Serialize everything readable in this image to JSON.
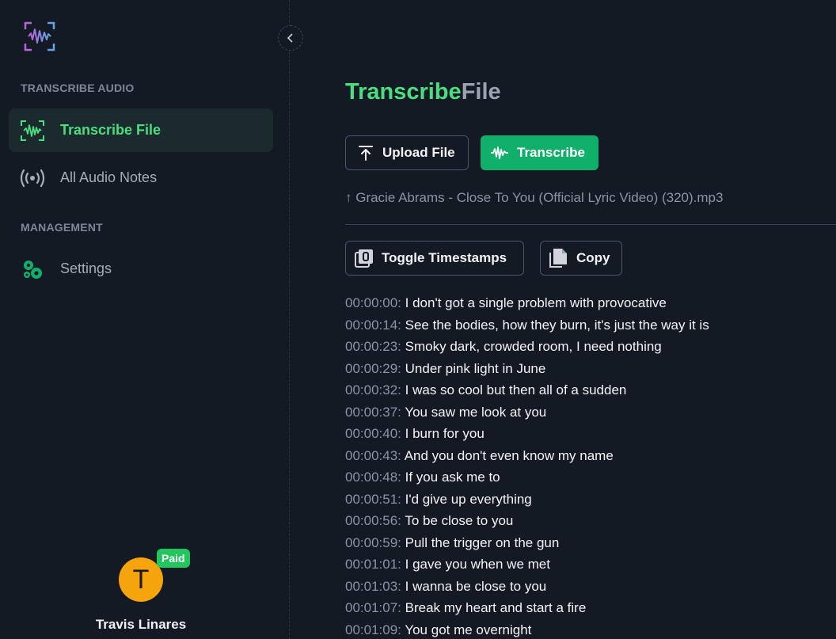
{
  "sidebar": {
    "sections": [
      {
        "title": "TRANSCRIBE AUDIO"
      },
      {
        "title": "MANAGEMENT"
      }
    ],
    "items": [
      {
        "label": "Transcribe File",
        "icon": "waveform-scan-icon"
      },
      {
        "label": "All Audio Notes",
        "icon": "broadcast-icon"
      },
      {
        "label": "Settings",
        "icon": "gears-icon"
      }
    ],
    "user": {
      "initial": "T",
      "badge": "Paid",
      "name": "Travis Linares"
    }
  },
  "main": {
    "title_part1": "Transcribe",
    "title_part2": "File",
    "upload_label": "Upload File",
    "transcribe_label": "Transcribe",
    "file_name": "↑ Gracie Abrams - Close To You (Official Lyric Video) (320).mp3",
    "toggle_label": "Toggle Timestamps",
    "copy_label": "Copy",
    "transcript": [
      {
        "time": "00:00:00:",
        "text": "I don't got a single problem with provocative"
      },
      {
        "time": "00:00:14:",
        "text": "See the bodies, how they burn, it's just the way it is"
      },
      {
        "time": "00:00:23:",
        "text": "Smoky dark, crowded room, I need nothing"
      },
      {
        "time": "00:00:29:",
        "text": "Under pink light in June"
      },
      {
        "time": "00:00:32:",
        "text": "I was so cool but then all of a sudden"
      },
      {
        "time": "00:00:37:",
        "text": "You saw me look at you"
      },
      {
        "time": "00:00:40:",
        "text": "I burn for you"
      },
      {
        "time": "00:00:43:",
        "text": "And you don't even know my name"
      },
      {
        "time": "00:00:48:",
        "text": "If you ask me to"
      },
      {
        "time": "00:00:51:",
        "text": "I'd give up everything"
      },
      {
        "time": "00:00:56:",
        "text": "To be close to you"
      },
      {
        "time": "00:00:59:",
        "text": "Pull the trigger on the gun"
      },
      {
        "time": "00:01:01:",
        "text": "I gave you when we met"
      },
      {
        "time": "00:01:03:",
        "text": "I wanna be close to you"
      },
      {
        "time": "00:01:07:",
        "text": "Break my heart and start a fire"
      },
      {
        "time": "00:01:09:",
        "text": "You got me overnight"
      }
    ]
  },
  "colors": {
    "accent_green": "#4ade80",
    "button_green": "#10b06a",
    "background": "#141a24",
    "avatar": "#f5a50b"
  }
}
